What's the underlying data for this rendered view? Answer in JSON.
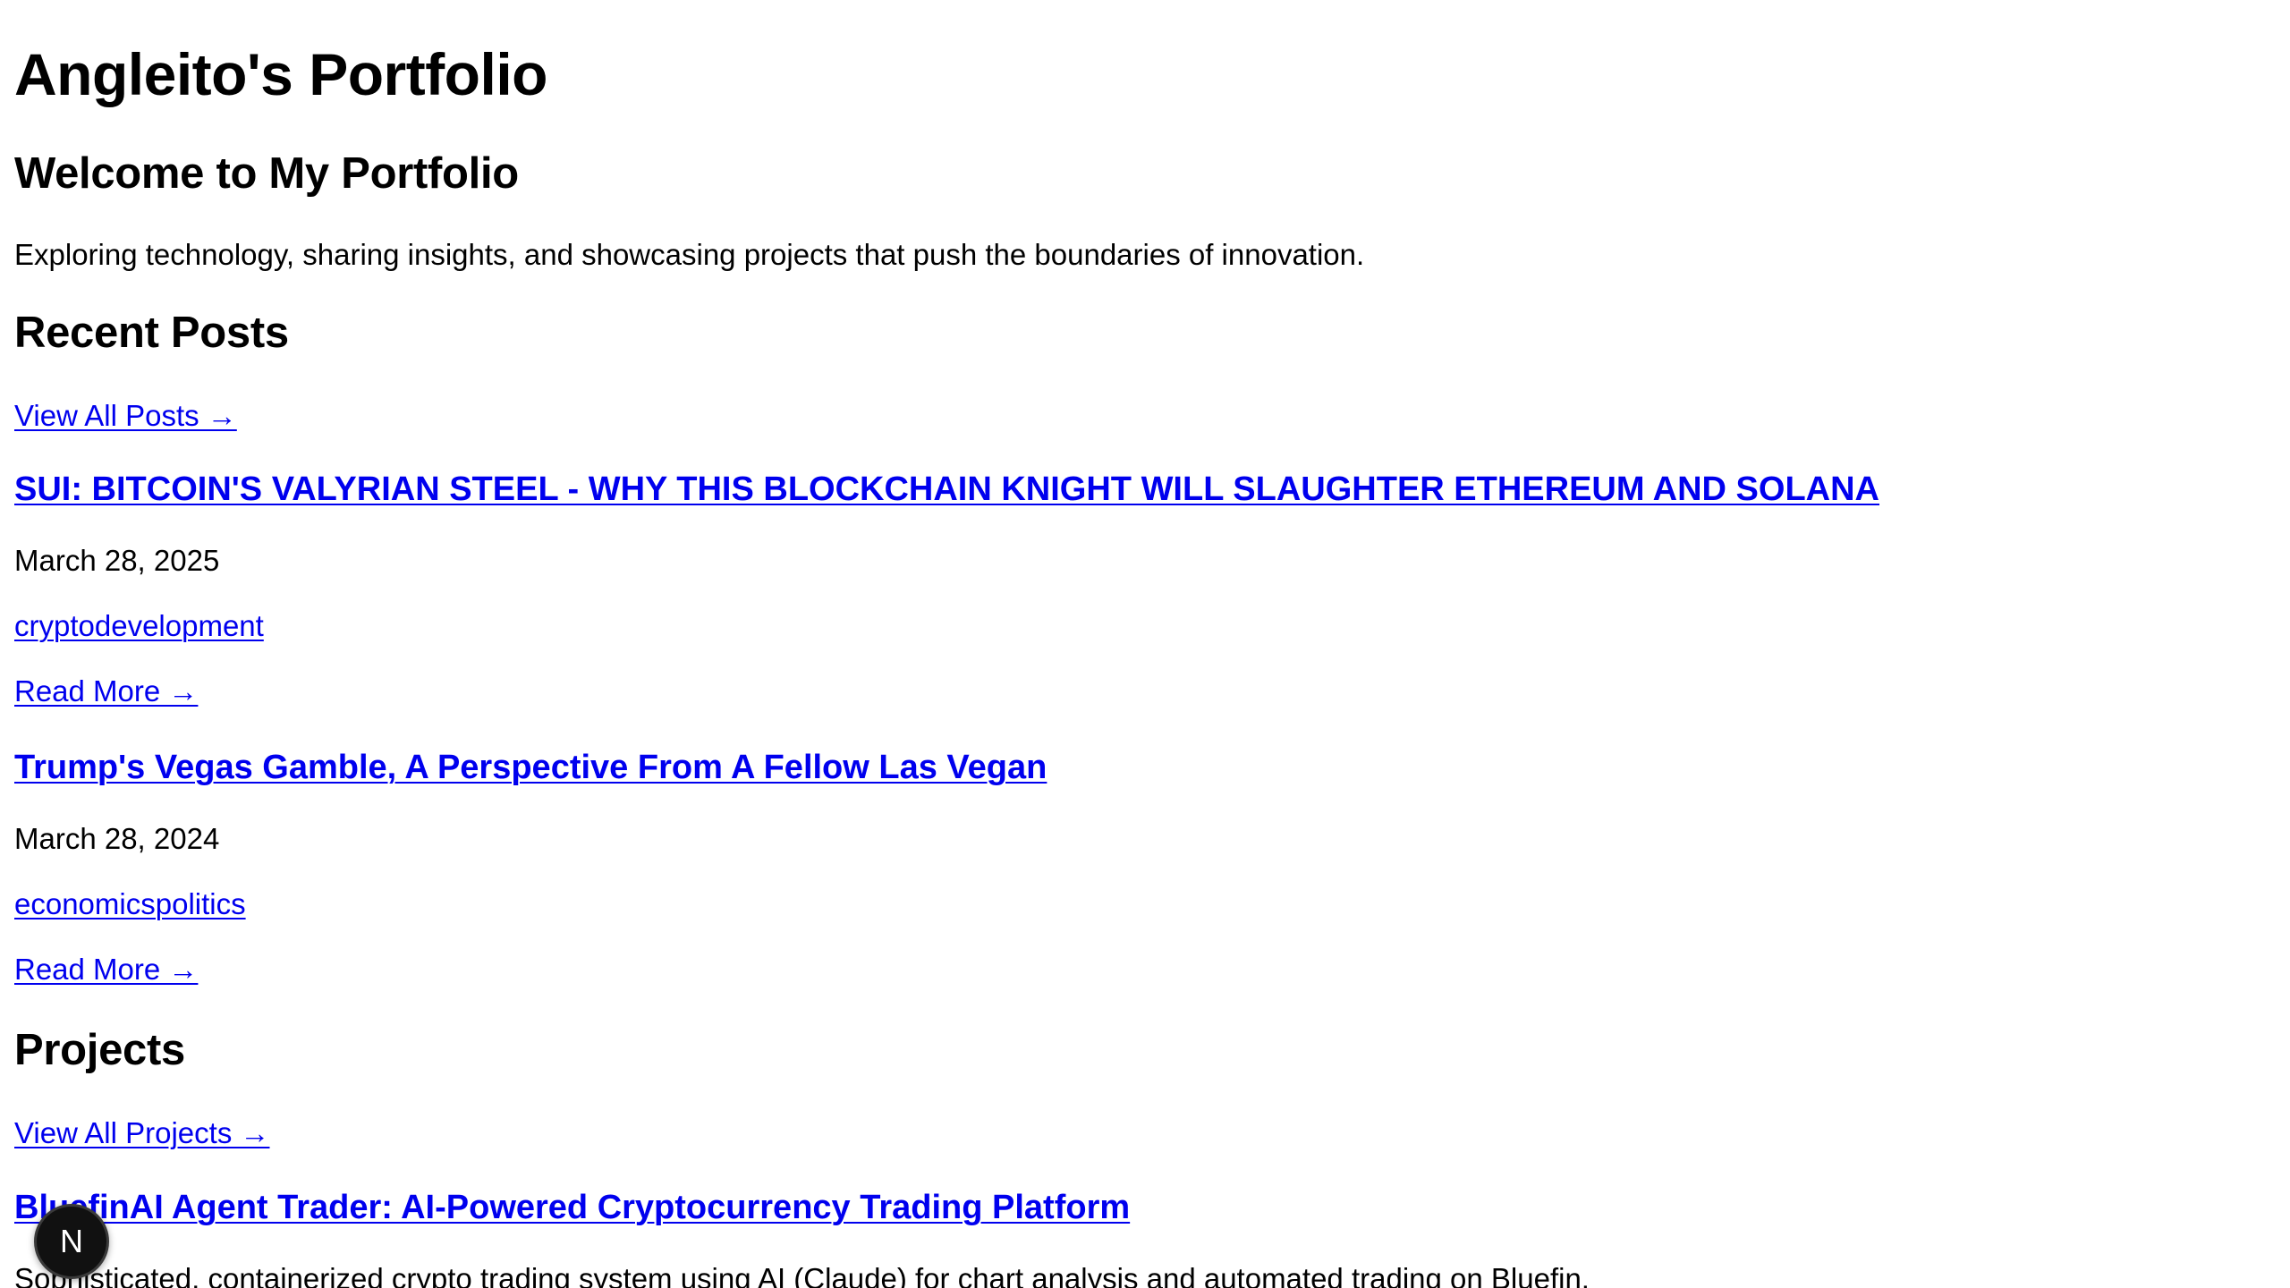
{
  "site": {
    "title": "Angleito's Portfolio"
  },
  "hero": {
    "heading": "Welcome to My Portfolio",
    "tagline": "Exploring technology, sharing insights, and showcasing projects that push the boundaries of innovation."
  },
  "recent_posts": {
    "heading": "Recent Posts",
    "view_all_label": "View All Posts →",
    "posts": [
      {
        "title": "SUI: BITCOIN'S VALYRIAN STEEL - WHY THIS BLOCKCHAIN KNIGHT WILL SLAUGHTER ETHEREUM AND SOLANA",
        "date": "March 28, 2025",
        "tags": "cryptodevelopment",
        "read_more": "Read More →"
      },
      {
        "title": "Trump's Vegas Gamble, A Perspective From A Fellow Las Vegan",
        "date": "March 28, 2024",
        "tags": "economicspolitics",
        "read_more": "Read More →"
      }
    ]
  },
  "projects": {
    "heading": "Projects",
    "view_all_label": "View All Projects →",
    "items": [
      {
        "title": "BluefinAI Agent Trader: AI-Powered Cryptocurrency Trading Platform",
        "description": "Sophisticated, containerized crypto trading system using AI (Claude) for chart analysis and automated trading on Bluefin."
      }
    ]
  },
  "dev_badge": {
    "icon": "nextjs-n-icon",
    "letter": "N"
  },
  "colors": {
    "link": "#0000ee",
    "text": "#000000",
    "background": "#ffffff",
    "badge": "#111111"
  }
}
